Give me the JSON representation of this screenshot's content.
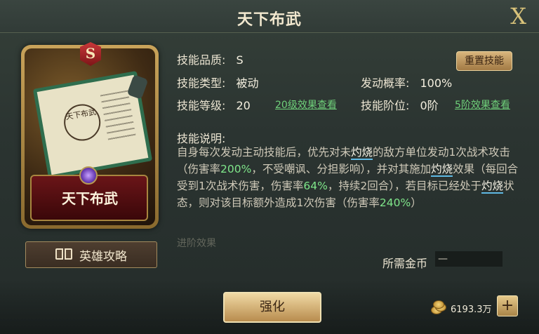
{
  "header": {
    "title": "天下布武",
    "close_label": "X"
  },
  "card": {
    "grade": "S",
    "name": "天下布武",
    "seal_text": "天下布武"
  },
  "guide_button": {
    "label": "英雄攻略"
  },
  "info": {
    "quality_label": "技能品质:",
    "quality_value": "S",
    "type_label": "技能类型:",
    "type_value": "被动",
    "prob_label": "发动概率:",
    "prob_value": "100%",
    "level_label": "技能等级:",
    "level_value": "20",
    "level_link": "20级效果查看",
    "tier_label": "技能阶位:",
    "tier_value": "0阶",
    "tier_link": "5阶效果查看",
    "reset_button": "重置技能"
  },
  "description": {
    "title": "技能说明:",
    "p1": "自身每次发动主动技能后，优先对未",
    "kw1": "灼烧",
    "p2": "的敌方单位发动1次战术攻击（伤害率",
    "n1": "200%",
    "p3": "，不受嘲讽、分担影响），并对其施加",
    "kw2": "灼烧",
    "p4": "效果（每回合受到1次战术伤害，伤害率",
    "n2": "64%",
    "p5": "，持续2回合），若目标已经处于",
    "kw3": "灼烧",
    "p6": "状态，则对该目标额外造成1次伤害（伤害率",
    "n3": "240%",
    "p7": "）"
  },
  "advance_section": "进阶效果",
  "cost": {
    "label": "所需金币",
    "value": "—"
  },
  "footer": {
    "strengthen_label": "强化",
    "gold_amount": "6193.3万",
    "plus_label": "+"
  }
}
